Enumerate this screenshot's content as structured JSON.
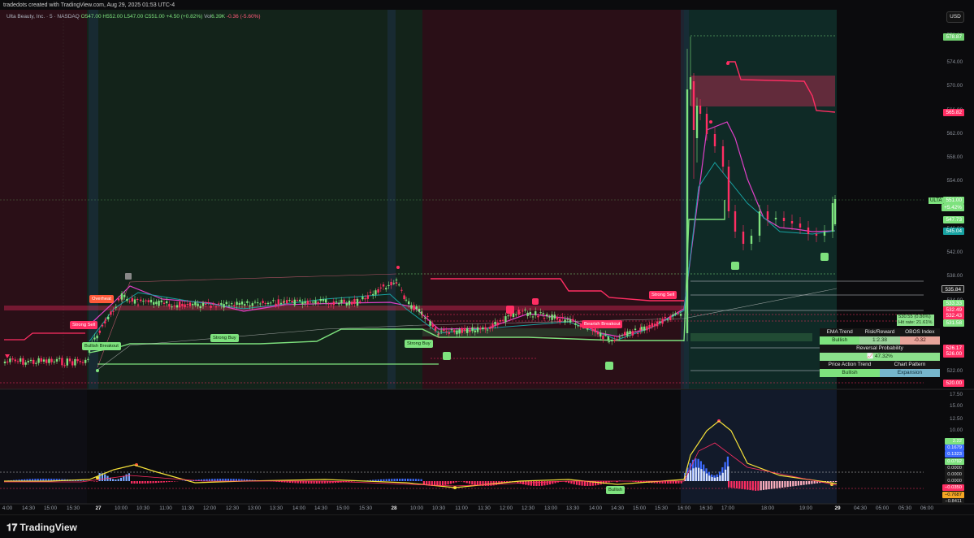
{
  "header": {
    "attribution": "tradedots created with TradingView.com, Aug 29, 2025 01:53 UTC-4",
    "symbol": "Ulta Beauty, Inc. · 5 · NASDAQ",
    "open": "O547.00",
    "high": "H552.00",
    "low": "L547.00",
    "close": "C551.00",
    "change": "+4.50 (+0.82%)",
    "vol": "Vol",
    "vol_value": "6.39K",
    "vol_change": "-0.36 (-5.60%)",
    "currency": "USD"
  },
  "price_axis": {
    "labels": [
      "578.00",
      "574.00",
      "570.00",
      "566.00",
      "562.00",
      "558.00",
      "554.00",
      "550.00",
      "546.00",
      "542.00",
      "538.00",
      "534.00",
      "530.00",
      "526.00",
      "522.00"
    ],
    "tags": [
      {
        "text": "578.87",
        "color": "#6fcf6f"
      },
      {
        "text": "565.82",
        "color": "#ff2e63"
      },
      {
        "text": "551.00",
        "color": "#7ee27e"
      },
      {
        "text": "+5.42%",
        "color": "#7ee27e"
      },
      {
        "text": "547.73",
        "color": "#7ee27e"
      },
      {
        "text": "545.04",
        "color": "#17a2a2"
      },
      {
        "text": "535.84",
        "color": "#1a1a1a"
      },
      {
        "text": "533.33",
        "color": "#7ee27e"
      },
      {
        "text": "532.49",
        "color": "#ff2e63"
      },
      {
        "text": "532.43",
        "color": "#ff2e63"
      },
      {
        "text": "531.58",
        "color": "#7ee27e"
      },
      {
        "text": "526.17",
        "color": "#ff2e63"
      },
      {
        "text": "526.00",
        "color": "#ff2e63"
      },
      {
        "text": "520.00",
        "color": "#ff2e63"
      }
    ],
    "symbol_tag": "ULTA"
  },
  "osc_axis": {
    "labels": [
      "17.50",
      "15.00",
      "12.50",
      "10.00",
      "7.50",
      "5.00",
      "2.50",
      "0.0000",
      "-2.50",
      "-5.00"
    ],
    "tags": [
      {
        "text": "2.22",
        "color": "#7ee27e"
      },
      {
        "text": "0.1679",
        "color": "#3d6bff"
      },
      {
        "text": "0.1323",
        "color": "#3d6bff"
      },
      {
        "text": "0.0792",
        "color": "#7ee27e"
      },
      {
        "text": "0.0000",
        "color": "#1a1a1a"
      },
      {
        "text": "0.0000",
        "color": "#1a1a1a"
      },
      {
        "text": "0.0000",
        "color": "#1a1a1a"
      },
      {
        "text": "−0.0350",
        "color": "#ff2e63"
      },
      {
        "text": "−0.7687",
        "color": "#f5a623"
      },
      {
        "text": "−0.8411",
        "color": "#1a1a1a"
      }
    ]
  },
  "time_axis": [
    "4:00",
    "14:30",
    "15:00",
    "15:30",
    "27",
    "10:00",
    "10:30",
    "11:00",
    "11:30",
    "12:00",
    "12:30",
    "13:00",
    "13:30",
    "14:00",
    "14:30",
    "15:00",
    "15:30",
    "28",
    "10:00",
    "10:30",
    "11:00",
    "11:30",
    "12:00",
    "12:30",
    "13:00",
    "13:30",
    "14:00",
    "14:30",
    "15:00",
    "15:30",
    "16:00",
    "16:30",
    "17:00",
    "18:00",
    "19:00",
    "29",
    "04:30",
    "05:00",
    "05:30",
    "06:00"
  ],
  "signals": {
    "strong_sell_1": "Strong Sell",
    "overheat": "Overheat",
    "bullish_breakout": "Bullish Breakout",
    "strong_buy_1": "Strong Buy",
    "strong_buy_2": "Strong Buy",
    "bearish_breakout": "Bearish Breakout",
    "strong_sell_2": "Strong Sell",
    "osc_bullish": "Bullish"
  },
  "stats_box": {
    "level": "530.55 (0.86%)",
    "hit_rate": "Hit rate: 21.61%"
  },
  "table": {
    "h1": "EMA Trend",
    "h2": "Risk/Reward",
    "h3": "OBOS Index",
    "v1": "Bullish",
    "v2": "1:2.38",
    "v3": "-0.32",
    "rev_header": "Reversal Probability",
    "rev_value": "📈 47.32%",
    "h4": "Price Action Trend",
    "h5": "Chart Pattern",
    "v4": "Bullish",
    "v5": "Expansion"
  },
  "footer": {
    "logo": "TradingView"
  },
  "chart_data": {
    "type": "line",
    "title": "Ulta Beauty, Inc. · 5 · NASDAQ",
    "y_range": [
      520,
      579
    ],
    "last_price": 551.0,
    "approx_path": [
      {
        "t": "Aug 26 14:00",
        "y": 524
      },
      {
        "t": "Aug 27 09:30",
        "y": 526
      },
      {
        "t": "Aug 27 10:00",
        "y": 533
      },
      {
        "t": "Aug 27 13:00",
        "y": 534
      },
      {
        "t": "Aug 28 09:30",
        "y": 537
      },
      {
        "t": "Aug 28 10:30",
        "y": 529
      },
      {
        "t": "Aug 28 14:00",
        "y": 528
      },
      {
        "t": "Aug 28 16:00",
        "y": 534
      },
      {
        "t": "Aug 28 16:10",
        "y": 576
      },
      {
        "t": "Aug 28 17:00",
        "y": 548
      },
      {
        "t": "Aug 28 19:00",
        "y": 546
      },
      {
        "t": "Aug 28 19:55",
        "y": 551
      }
    ]
  }
}
